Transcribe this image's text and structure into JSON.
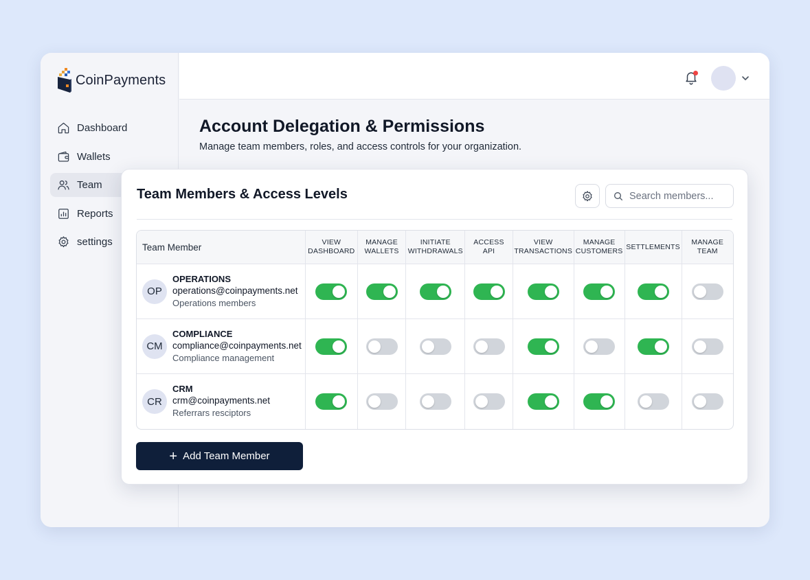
{
  "brand": {
    "name": "CoinPayments"
  },
  "sidebar": {
    "items": [
      {
        "label": "Dashboard",
        "icon": "home-icon",
        "active": false
      },
      {
        "label": "Wallets",
        "icon": "wallet-icon",
        "active": false
      },
      {
        "label": "Team",
        "icon": "users-icon",
        "active": true
      },
      {
        "label": "Reports",
        "icon": "reports-icon",
        "active": false
      },
      {
        "label": "settings",
        "icon": "gear-icon",
        "active": false
      }
    ]
  },
  "header": {
    "title": "Account Delegation & Permissions",
    "subtitle": "Manage team members, roles, and access controls for your organization."
  },
  "card": {
    "title": "Team Members & Access Levels",
    "search_placeholder": "Search members...",
    "add_button_label": "Add Team Member"
  },
  "table": {
    "member_header": "Team Member",
    "permissions": [
      [
        "VIEW",
        "DASHBOARD"
      ],
      [
        "MANAGE",
        "WALLETS"
      ],
      [
        "INITIATE",
        "WITHDRAWALS"
      ],
      [
        "ACCESS",
        "API"
      ],
      [
        "VIEW",
        "TRANSACTIONS"
      ],
      [
        "MANAGE",
        "CUSTOMERS"
      ],
      [
        "SETTLEMENTS"
      ],
      [
        "MANAGE",
        "TEAM"
      ]
    ],
    "rows": [
      {
        "initials": "OP",
        "name": "OPERATIONS",
        "email": "operations@coinpayments.net",
        "role": "Operations members",
        "toggles": [
          true,
          true,
          true,
          true,
          true,
          true,
          true,
          false
        ]
      },
      {
        "initials": "CM",
        "name": "COMPLIANCE",
        "email": "compliance@coinpayments.net",
        "role": "Compliance management",
        "toggles": [
          true,
          false,
          false,
          false,
          true,
          false,
          true,
          false
        ]
      },
      {
        "initials": "CR",
        "name": "CRM",
        "email": "crm@coinpayments.net",
        "role": "Referrars resciptors",
        "toggles": [
          true,
          false,
          false,
          false,
          true,
          true,
          false,
          false
        ]
      }
    ]
  },
  "colors": {
    "toggle_on": "#2fb552",
    "toggle_off": "#d1d5db",
    "primary_button": "#0f1f3a",
    "notification_dot": "#ef4444",
    "background": "#dde8fb"
  }
}
